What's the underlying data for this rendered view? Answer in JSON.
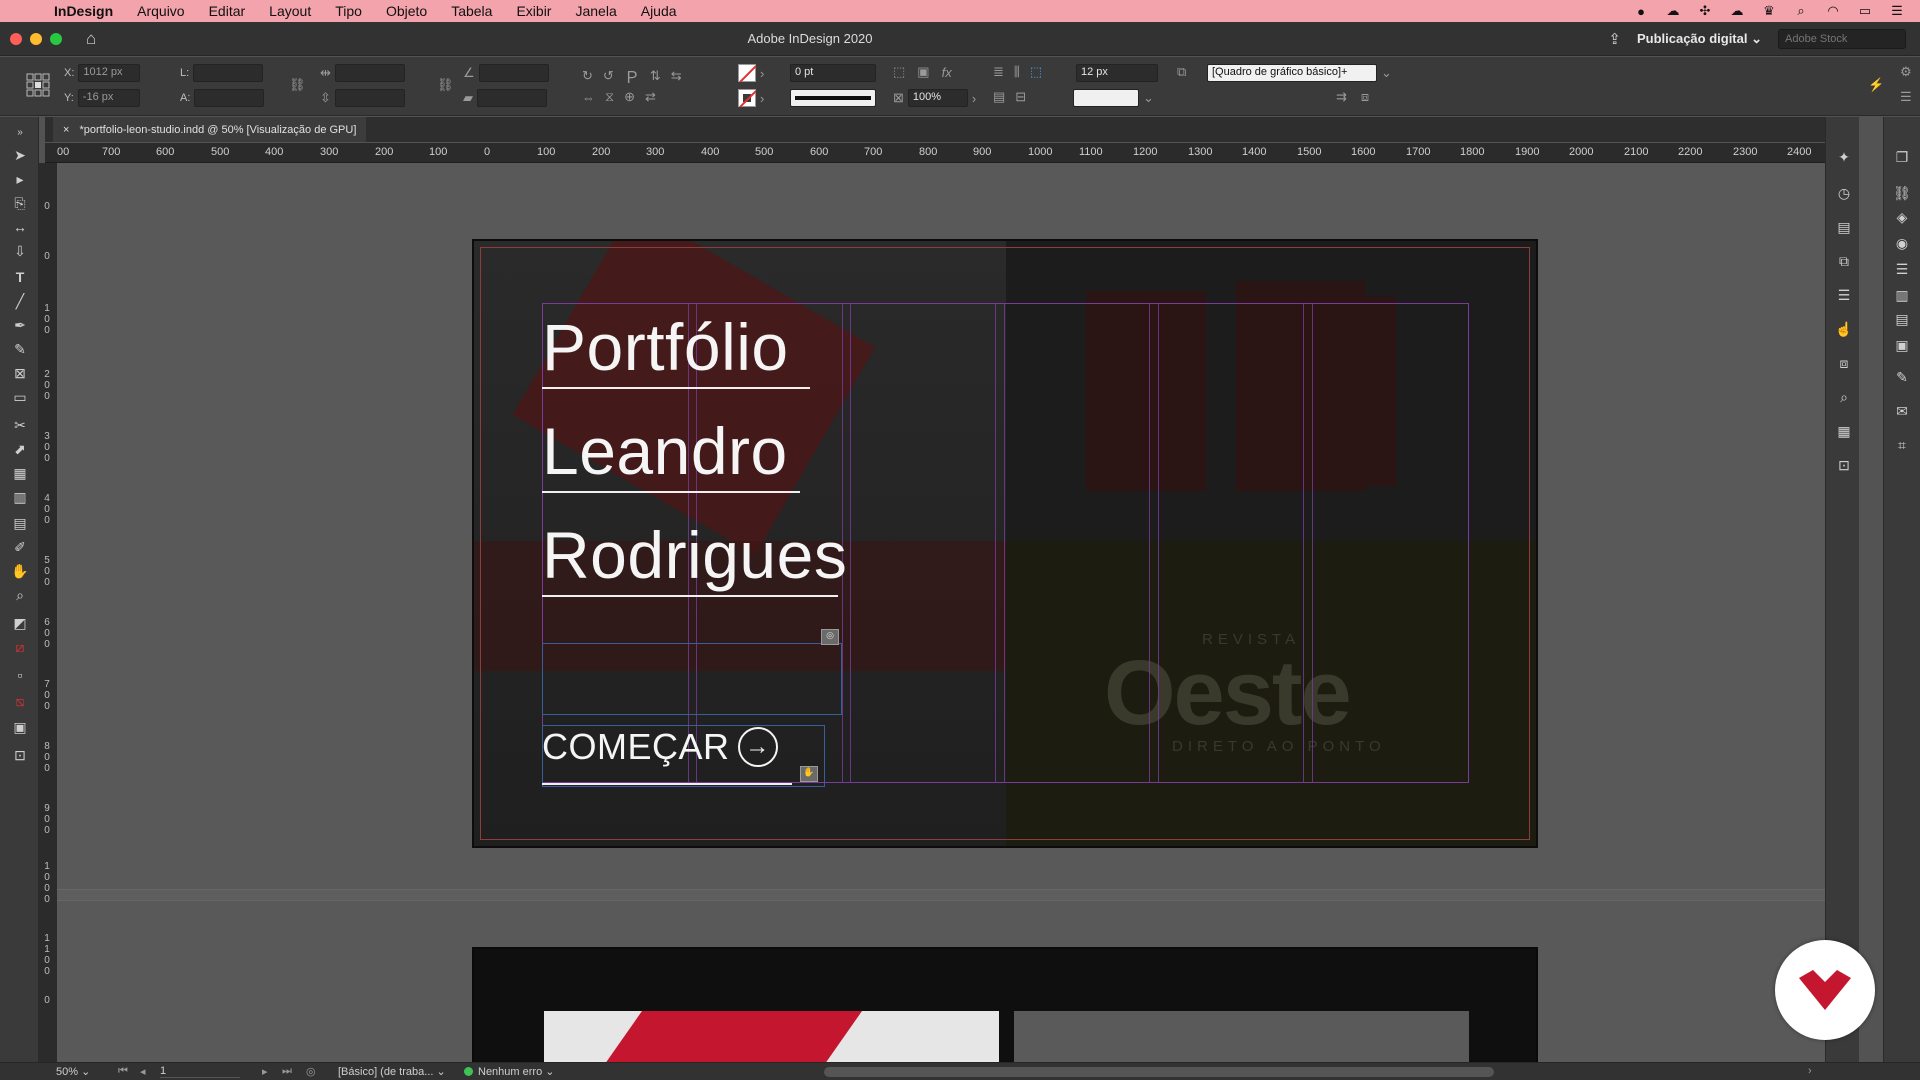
{
  "menubar": {
    "app": "InDesign",
    "items": [
      "Arquivo",
      "Editar",
      "Layout",
      "Tipo",
      "Objeto",
      "Tabela",
      "Exibir",
      "Janela",
      "Ajuda"
    ]
  },
  "appbar": {
    "title": "Adobe InDesign 2020",
    "workspace": "Publicação digital",
    "stock_placeholder": "Adobe Stock"
  },
  "control": {
    "x_label": "X:",
    "x_value": "1012 px",
    "y_label": "Y:",
    "y_value": "-16 px",
    "l_label": "L:",
    "a_label": "A:",
    "stroke_weight": "0 pt",
    "opacity": "100%",
    "spacing": "12 px",
    "object_style": "[Quadro de gráfico básico]+"
  },
  "document": {
    "tab_label": "*portfolio-leon-studio.indd @ 50% [Visualização de GPU]"
  },
  "ruler": {
    "h_labels": [
      "00",
      "700",
      "600",
      "500",
      "400",
      "300",
      "200",
      "100",
      "0",
      "100",
      "200",
      "300",
      "400",
      "500",
      "600",
      "700",
      "800",
      "900",
      "1000",
      "1100",
      "1200",
      "1300",
      "1400",
      "1500",
      "1600",
      "1700",
      "1800",
      "1900",
      "2000",
      "2100",
      "2200",
      "2300",
      "2400"
    ],
    "v_labels": [
      "0",
      "0",
      "1 0 0",
      "2 0 0",
      "3 0 0",
      "4 0 0",
      "5 0 0",
      "6 0 0",
      "7 0 0",
      "8 0 0",
      "9 0 0",
      "1 0 0 0",
      "1 1 0 0",
      "0"
    ]
  },
  "page": {
    "title_lines": [
      "Portfólio",
      "Leandro",
      "Rodrigues"
    ],
    "cta": "COMEÇAR",
    "magazine_prefix": "REVISTA",
    "magazine_name": "Oeste",
    "magazine_tagline": "DIRETO AO PONTO"
  },
  "status": {
    "zoom": "50%",
    "page_number": "1",
    "preflight_profile": "[Básico] (de traba...",
    "errors": "Nenhum erro"
  },
  "colors": {
    "menubar_bg": "#f2a3ab",
    "accent_red": "#c4162f",
    "guide_purple": "#7a3b9a"
  }
}
